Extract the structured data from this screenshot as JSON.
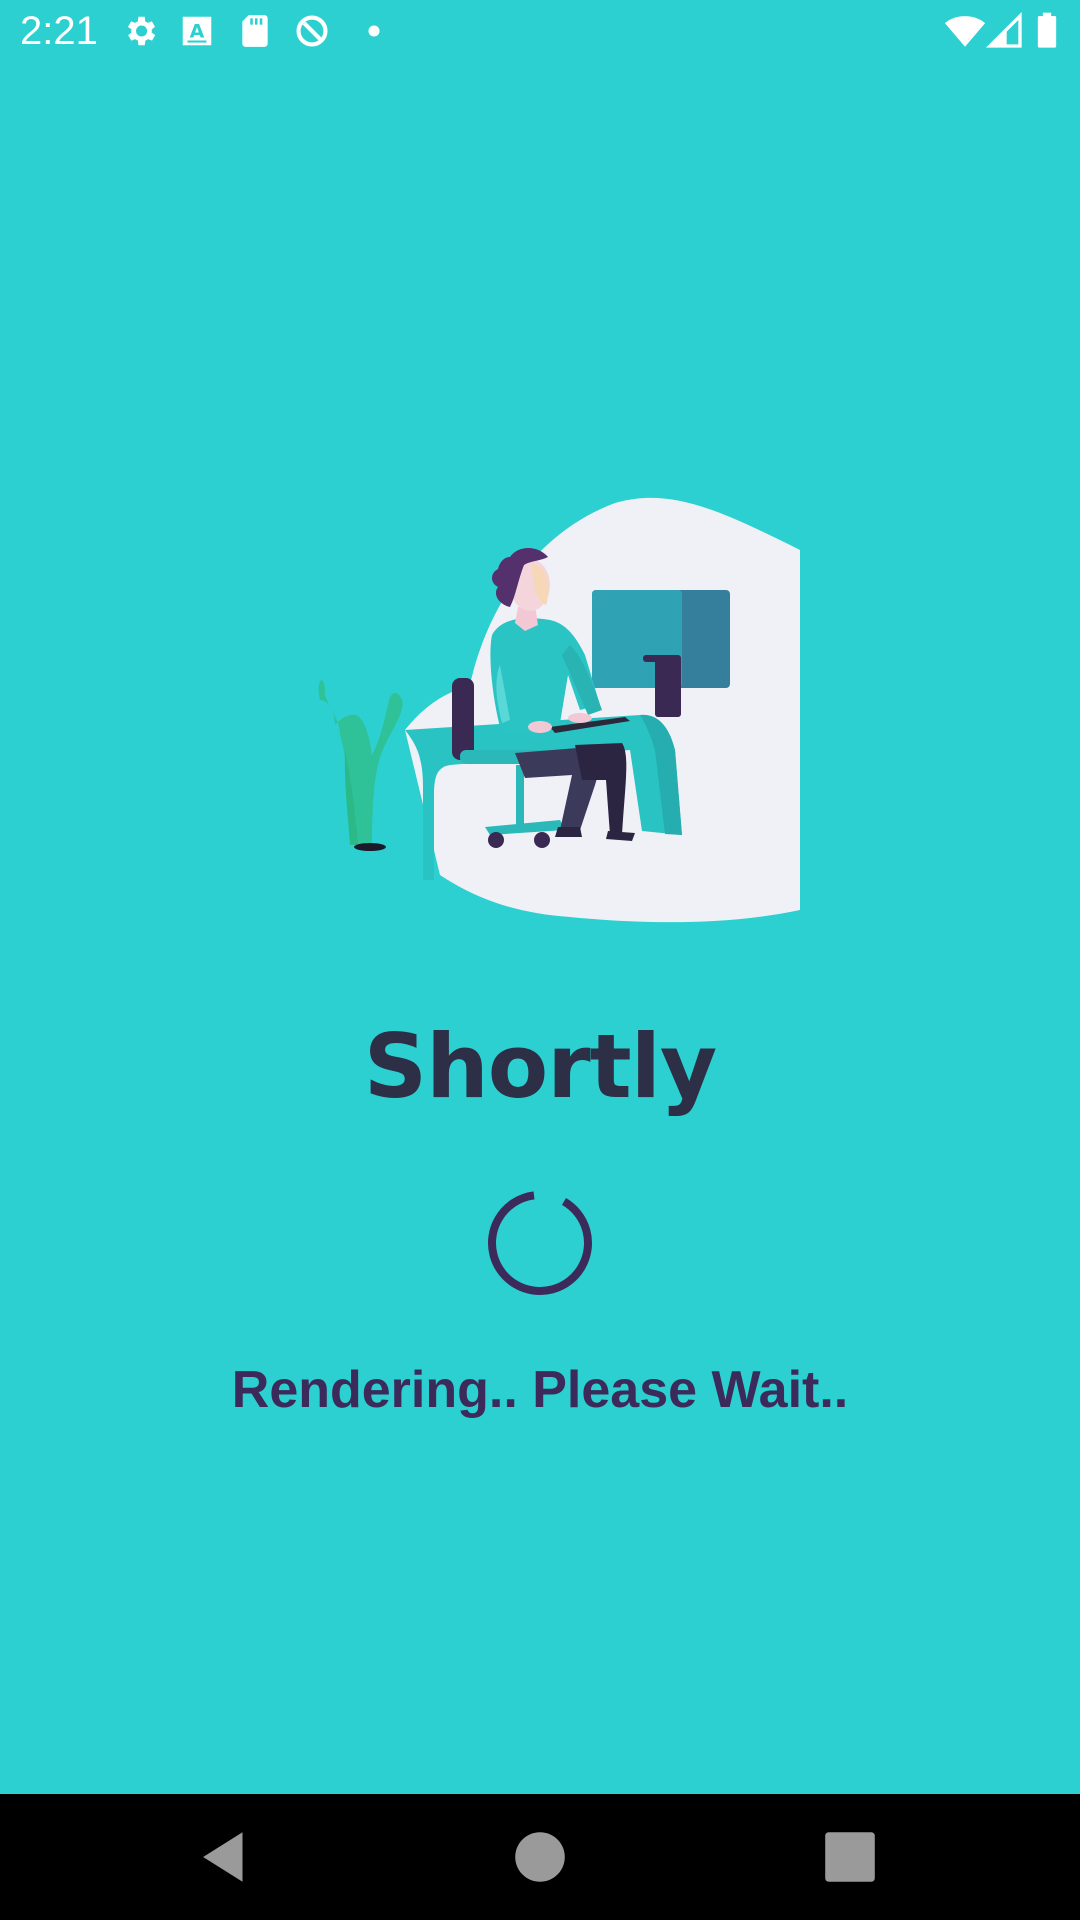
{
  "status_bar": {
    "time": "2:21",
    "left_icons": [
      "settings-icon",
      "font-a-icon",
      "sd-card-icon",
      "q-ring-icon",
      "dot-icon"
    ],
    "right_icons": [
      "wifi-icon",
      "signal-icon",
      "battery-icon"
    ]
  },
  "splash": {
    "title": "Shortly",
    "loading_text": "Rendering.. Please Wait..",
    "illustration": "person-working-at-desk-illustration"
  },
  "nav_bar": {
    "buttons": [
      "back-icon",
      "home-icon",
      "recents-icon"
    ]
  },
  "colors": {
    "background": "#2dd0d0",
    "title": "#2c2f45",
    "accent": "#3b2a5a",
    "nav_bar": "#000000"
  }
}
